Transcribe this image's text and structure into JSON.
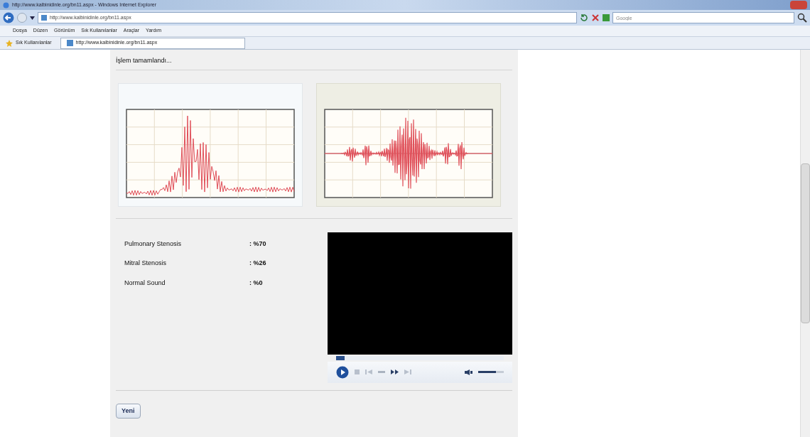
{
  "window": {
    "title": "http://www.kalbinidinle.org/bn11.aspx - Windows Internet Explorer"
  },
  "address_bar": {
    "value": "http://www.kalbinidinle.org/bn11.aspx"
  },
  "search": {
    "placeholder": "Google"
  },
  "menu": [
    "Dosya",
    "Düzen",
    "Görünüm",
    "Sık Kullanılanlar",
    "Araçlar",
    "Yardım"
  ],
  "favorites": {
    "label": "Sık Kullanılanlar"
  },
  "tab": {
    "label": "http://www.kalbinidinle.org/bn11.aspx",
    "selected": true
  },
  "page": {
    "status": "İşlem tamamlandı...",
    "charts": [
      {
        "kind": "spectrum"
      },
      {
        "kind": "wave"
      }
    ],
    "results": [
      {
        "label": "Pulmonary Stenosis",
        "value": ": %70"
      },
      {
        "label": "Mitral Stenosis",
        "value": ": %26"
      },
      {
        "label": "Normal Sound",
        "value": ": %0"
      }
    ],
    "player": {
      "progress": {
        "level": 0.05
      },
      "volume": {
        "level": 0.7
      }
    },
    "button": "Yeni"
  }
}
